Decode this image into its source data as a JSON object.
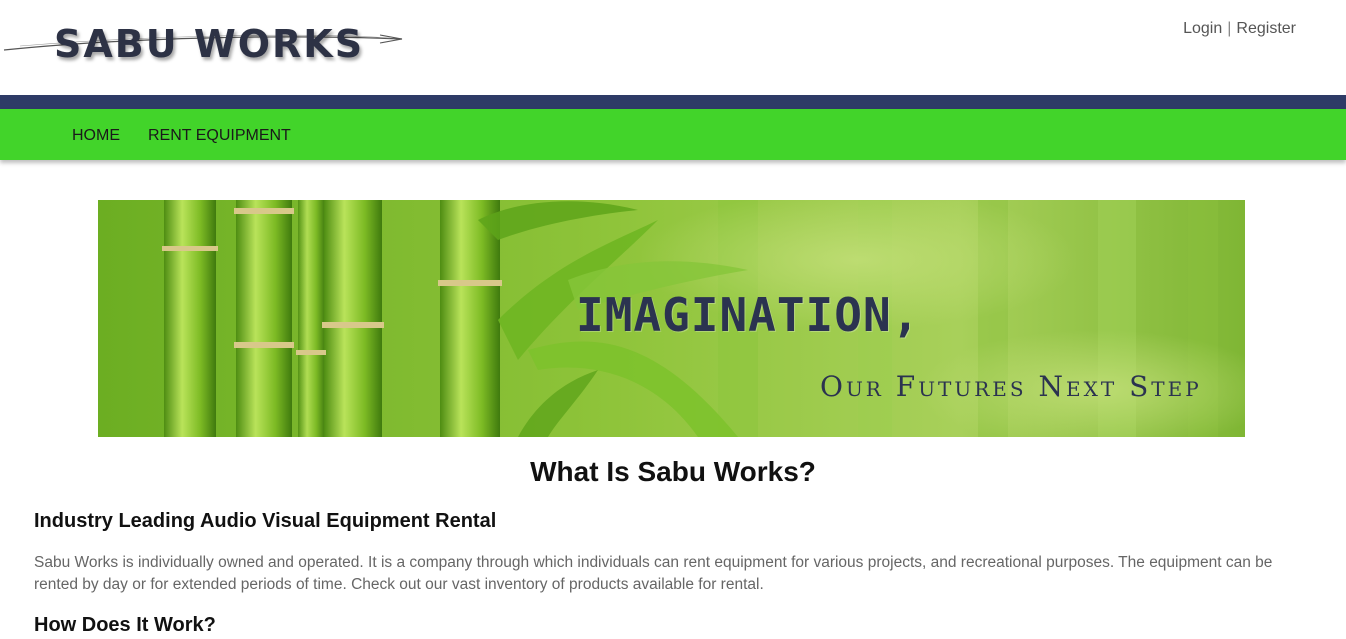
{
  "header": {
    "logo_text": "SABU WORKS",
    "login_label": "Login",
    "separator": "|",
    "register_label": "Register"
  },
  "nav": {
    "home_label": "HOME",
    "rent_label": "RENT EQUIPMENT"
  },
  "banner": {
    "title": "IMAGINATION,",
    "subtitle": "Our Futures Next Step"
  },
  "content": {
    "heading": "What Is Sabu Works?",
    "section1_heading": "Industry Leading Audio Visual Equipment Rental",
    "section1_text": "Sabu Works is individually owned and operated. It is a company through which individuals can rent equipment for various projects, and recreational purposes. The equipment can be rented by day or for extended periods of time. Check out our vast inventory of products available for rental.",
    "section2_heading": "How Does It Work?"
  },
  "colors": {
    "nav_green": "#42d42a",
    "nav_navy": "#2e3b66",
    "logo_text": "#2d3245"
  }
}
